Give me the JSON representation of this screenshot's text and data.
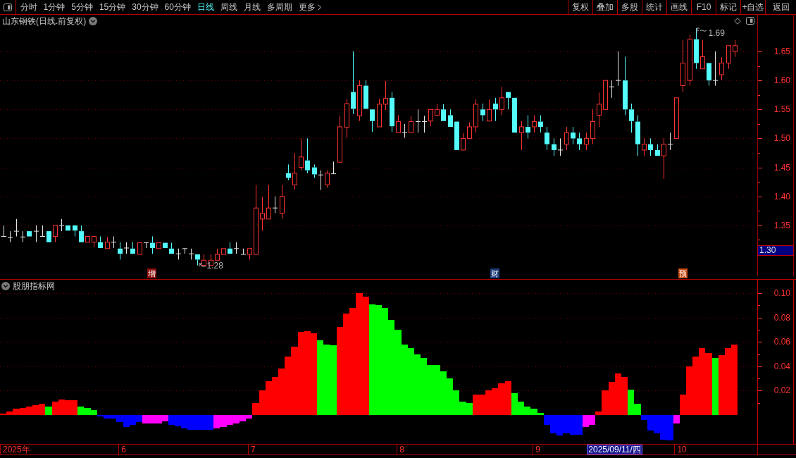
{
  "toolbar": {
    "tabs": [
      {
        "label": "分时",
        "selected": false,
        "kind": "period"
      },
      {
        "label": "1分钟",
        "selected": false,
        "kind": "period"
      },
      {
        "label": "5分钟",
        "selected": false,
        "kind": "period"
      },
      {
        "label": "15分钟",
        "selected": false,
        "kind": "period"
      },
      {
        "label": "30分钟",
        "selected": false,
        "kind": "period"
      },
      {
        "label": "60分钟",
        "selected": false,
        "kind": "period"
      },
      {
        "label": "日线",
        "selected": true,
        "kind": "period"
      },
      {
        "label": "周线",
        "selected": false,
        "kind": "period"
      },
      {
        "label": "月线",
        "selected": false,
        "kind": "period"
      },
      {
        "label": "多周期",
        "selected": false,
        "kind": "period"
      },
      {
        "label": "更多",
        "selected": false,
        "kind": "menu"
      }
    ],
    "buttons": [
      "复权",
      "叠加",
      "多股",
      "统计",
      "画线",
      "F10",
      "标记",
      "+自选",
      "返回"
    ]
  },
  "price_panel": {
    "title": "山东钢铁(日线.前复权)",
    "high_marker": "1.69",
    "low_marker": "1.28",
    "event_tags": [
      {
        "label": "增",
        "color": "#8a0c0c"
      },
      {
        "label": "财",
        "color": "#1c3d78"
      },
      {
        "label": "预",
        "color": "#c44a12"
      }
    ],
    "axis_labels": [
      "1.65",
      "1.60",
      "1.55",
      "1.50",
      "1.45",
      "1.40",
      "1.35"
    ],
    "current_price": "1.30"
  },
  "indicator_panel": {
    "title": "股朋指标网",
    "chart_data": {
      "type": "bar",
      "series": [
        {
          "color": "#ff0000",
          "values": [
            0.001,
            0.003,
            0.005,
            0.006,
            0.007,
            0.008,
            0.009,
            null,
            0.011,
            0.013,
            0.012,
            0.012,
            null,
            null,
            null,
            null,
            null,
            null,
            null,
            null,
            null,
            null,
            null,
            null,
            null,
            null,
            null,
            null,
            null,
            null,
            null,
            null,
            null,
            null,
            null,
            null,
            null,
            null,
            null,
            0.01,
            0.02,
            0.028,
            0.031,
            0.038,
            0.048,
            0.056,
            0.068,
            0.069,
            0.067,
            null,
            null,
            null,
            0.072,
            0.083,
            0.088,
            0.1,
            0.097,
            null,
            null,
            null,
            null,
            null,
            null,
            null,
            null,
            null,
            null,
            null,
            null,
            null,
            null,
            null,
            null,
            0.017,
            0.017,
            0.02,
            0.022,
            0.026,
            0.028,
            null,
            null,
            null,
            null,
            null,
            null,
            null,
            null,
            null,
            null,
            null,
            null,
            null,
            0.003,
            0.02,
            0.027,
            0.034,
            0.031,
            null,
            null,
            null,
            null,
            null,
            null,
            null,
            null,
            0.017,
            0.04,
            0.048,
            0.055,
            0.051,
            null,
            0.049,
            0.055,
            0.058,
            null,
            null,
            null
          ]
        },
        {
          "color": "#00ff00",
          "values": [
            null,
            null,
            null,
            null,
            null,
            null,
            null,
            0.007,
            null,
            null,
            null,
            null,
            0.007,
            0.006,
            0.004,
            null,
            null,
            null,
            null,
            null,
            null,
            null,
            null,
            null,
            null,
            null,
            null,
            null,
            null,
            null,
            null,
            null,
            null,
            null,
            null,
            null,
            null,
            null,
            null,
            null,
            null,
            null,
            null,
            null,
            null,
            null,
            null,
            null,
            null,
            0.061,
            0.058,
            0.057,
            null,
            null,
            null,
            null,
            null,
            0.091,
            0.09,
            0.088,
            0.078,
            0.07,
            0.058,
            0.055,
            0.05,
            0.047,
            0.041,
            0.041,
            0.036,
            0.03,
            0.02,
            0.011,
            0.01,
            null,
            null,
            null,
            null,
            null,
            null,
            0.018,
            0.011,
            0.007,
            0.005,
            0.002,
            null,
            null,
            null,
            null,
            null,
            null,
            null,
            null,
            null,
            null,
            null,
            null,
            null,
            0.021,
            0.009,
            null,
            null,
            null,
            null,
            null,
            null,
            null,
            null,
            null,
            null,
            null,
            0.047,
            null,
            null,
            null,
            null,
            null,
            null
          ]
        },
        {
          "color": "#0000ff",
          "values": [
            null,
            null,
            null,
            null,
            null,
            null,
            null,
            null,
            null,
            null,
            null,
            null,
            null,
            null,
            null,
            -0.001,
            -0.003,
            -0.003,
            -0.006,
            -0.01,
            -0.008,
            -0.006,
            null,
            null,
            null,
            null,
            -0.008,
            -0.009,
            -0.011,
            -0.012,
            -0.012,
            -0.012,
            -0.012,
            null,
            null,
            null,
            null,
            null,
            null,
            null,
            null,
            null,
            null,
            null,
            null,
            null,
            null,
            null,
            null,
            null,
            null,
            null,
            null,
            null,
            null,
            null,
            null,
            null,
            null,
            null,
            null,
            null,
            null,
            null,
            null,
            null,
            null,
            null,
            null,
            null,
            null,
            null,
            null,
            null,
            null,
            null,
            null,
            null,
            null,
            null,
            null,
            null,
            null,
            null,
            -0.008,
            -0.015,
            -0.017,
            -0.015,
            -0.016,
            -0.016,
            null,
            null,
            null,
            null,
            null,
            null,
            null,
            null,
            null,
            -0.004,
            -0.013,
            -0.015,
            -0.02,
            -0.021,
            null,
            null,
            null,
            null,
            null,
            null,
            null,
            null,
            null,
            null,
            null,
            null,
            null
          ]
        },
        {
          "color": "#ff00ff",
          "values": [
            null,
            null,
            null,
            null,
            null,
            null,
            null,
            null,
            null,
            null,
            null,
            null,
            null,
            null,
            null,
            null,
            null,
            null,
            null,
            null,
            null,
            null,
            -0.007,
            -0.007,
            -0.007,
            -0.005,
            null,
            null,
            null,
            null,
            null,
            null,
            null,
            -0.011,
            -0.01,
            -0.008,
            -0.007,
            -0.005,
            -0.003,
            null,
            null,
            null,
            null,
            null,
            null,
            null,
            null,
            null,
            null,
            null,
            null,
            null,
            null,
            null,
            null,
            null,
            null,
            null,
            null,
            null,
            null,
            null,
            null,
            null,
            null,
            null,
            null,
            null,
            null,
            null,
            null,
            null,
            null,
            null,
            null,
            null,
            null,
            null,
            null,
            null,
            null,
            null,
            null,
            null,
            null,
            null,
            null,
            null,
            null,
            null,
            -0.01,
            -0.008,
            null,
            null,
            null,
            null,
            null,
            null,
            null,
            null,
            null,
            null,
            null,
            null,
            -0.007,
            null,
            null,
            null,
            null,
            null,
            null,
            null,
            null,
            null,
            null,
            null,
            null
          ]
        }
      ],
      "ylim": [
        -0.0237,
        0.111
      ],
      "yticks": [
        {
          "value": 0.02,
          "label": "0.02"
        },
        {
          "value": 0.04,
          "label": "0.04"
        },
        {
          "value": 0.06,
          "label": "0.06"
        },
        {
          "value": 0.08,
          "label": "0.08"
        },
        {
          "value": 0.1,
          "label": "0.10"
        }
      ],
      "grid": true
    }
  },
  "date_axis": {
    "labels": [
      "2025年",
      "6",
      "7",
      "8",
      "9",
      "10"
    ],
    "cursor_date": "2025/09/11/四"
  }
}
